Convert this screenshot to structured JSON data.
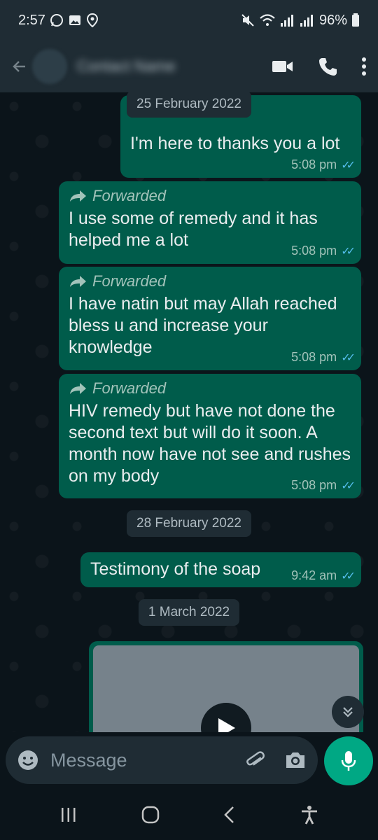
{
  "status_bar": {
    "time": "2:57",
    "battery": "96%",
    "left_icons": [
      "whatsapp-icon",
      "image-icon",
      "location-icon"
    ],
    "right_icons": [
      "mute-icon",
      "wifi-icon",
      "signal-icon",
      "signal-icon",
      "battery-icon"
    ]
  },
  "header": {
    "contact_name": "Contact Name",
    "actions": [
      "video-call-icon",
      "voice-call-icon",
      "more-icon"
    ]
  },
  "messages": [
    {
      "type": "date",
      "text": "25 February 2022"
    },
    {
      "type": "out",
      "forwarded": false,
      "text": "I'm here to thanks you a lot",
      "time": "5:08 pm"
    },
    {
      "type": "out",
      "forwarded": true,
      "forwarded_label": "Forwarded",
      "text": "I use some of remedy and it has helped me a lot",
      "time": "5:08 pm"
    },
    {
      "type": "out",
      "forwarded": true,
      "forwarded_label": "Forwarded",
      "text": "I have natin but may Allah reached bless u and increase your knowledge",
      "time": "5:08 pm"
    },
    {
      "type": "out",
      "forwarded": true,
      "forwarded_label": "Forwarded",
      "text": "HIV remedy but have not done the second text but will do it soon. A month now have not see and rushes on my body",
      "time": "5:08 pm"
    },
    {
      "type": "date",
      "text": "28 February 2022"
    },
    {
      "type": "out",
      "forwarded": false,
      "text": "Testimony of the soap",
      "time": "9:42 am"
    },
    {
      "type": "date",
      "text": "1 March 2022"
    },
    {
      "type": "media",
      "kind": "video"
    }
  ],
  "composer": {
    "placeholder": "Message",
    "icons": [
      "emoji-icon",
      "attach-icon",
      "camera-icon",
      "mic-icon"
    ]
  },
  "colors": {
    "background": "#0b141a",
    "header": "#1f2c34",
    "outgoing_bubble": "#005c4b",
    "accent": "#00a884",
    "read_ticks": "#53bdeb"
  }
}
